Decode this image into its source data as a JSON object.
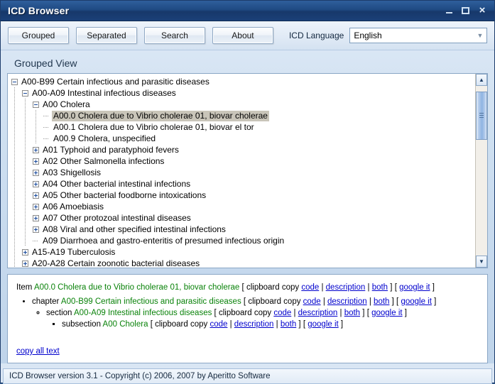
{
  "window": {
    "title": "ICD Browser",
    "controls": [
      {
        "name": "minimize",
        "glyph": "_"
      },
      {
        "name": "maximize",
        "glyph": "□"
      },
      {
        "name": "close",
        "glyph": "×"
      }
    ]
  },
  "toolbar": {
    "buttons": [
      "Grouped",
      "Separated",
      "Search",
      "About"
    ],
    "language_label": "ICD Language",
    "language_value": "English",
    "language_options": [
      "English"
    ]
  },
  "view": {
    "heading": "Grouped View"
  },
  "tree": {
    "nodes": [
      {
        "depth": 0,
        "toggle": "minus",
        "label": "A00-B99 Certain infectious and parasitic diseases",
        "selected": false
      },
      {
        "depth": 1,
        "toggle": "minus",
        "label": "A00-A09 Intestinal infectious diseases",
        "selected": false
      },
      {
        "depth": 2,
        "toggle": "minus",
        "label": "A00 Cholera",
        "selected": false
      },
      {
        "depth": 3,
        "toggle": "leaf",
        "label": "A00.0 Cholera due to Vibrio cholerae 01, biovar cholerae",
        "selected": true
      },
      {
        "depth": 3,
        "toggle": "leaf",
        "label": "A00.1 Cholera due to Vibrio cholerae 01, biovar el tor",
        "selected": false
      },
      {
        "depth": 3,
        "toggle": "leaf",
        "label": "A00.9 Cholera, unspecified",
        "selected": false
      },
      {
        "depth": 2,
        "toggle": "plus",
        "label": "A01 Typhoid and paratyphoid fevers",
        "selected": false
      },
      {
        "depth": 2,
        "toggle": "plus",
        "label": "A02 Other Salmonella infections",
        "selected": false
      },
      {
        "depth": 2,
        "toggle": "plus",
        "label": "A03 Shigellosis",
        "selected": false
      },
      {
        "depth": 2,
        "toggle": "plus",
        "label": "A04 Other bacterial intestinal infections",
        "selected": false
      },
      {
        "depth": 2,
        "toggle": "plus",
        "label": "A05 Other bacterial foodborne intoxications",
        "selected": false
      },
      {
        "depth": 2,
        "toggle": "plus",
        "label": "A06 Amoebiasis",
        "selected": false
      },
      {
        "depth": 2,
        "toggle": "plus",
        "label": "A07 Other protozoal intestinal diseases",
        "selected": false
      },
      {
        "depth": 2,
        "toggle": "plus",
        "label": "A08 Viral and other specified intestinal infections",
        "selected": false
      },
      {
        "depth": 2,
        "toggle": "leaf",
        "label": "A09 Diarrhoea and gastro-enteritis of presumed infectious origin",
        "selected": false
      },
      {
        "depth": 1,
        "toggle": "plus",
        "label": "A15-A19 Tuberculosis",
        "selected": false
      },
      {
        "depth": 1,
        "toggle": "plus",
        "label": "A20-A28 Certain zoonotic bacterial diseases",
        "selected": false
      }
    ],
    "scrollbar": {
      "up_glyph": "▲",
      "down_glyph": "▼"
    }
  },
  "detail": {
    "item": {
      "prefix": "Item",
      "code_text": "A00.0 Cholera due to Vibrio cholerae 01, biovar cholerae",
      "open_bracket": "[",
      "clipboard_label": "clipboard copy",
      "link_code": "code",
      "sep": "|",
      "link_description": "description",
      "link_both": "both",
      "close_bracket": "]",
      "google_open": "[",
      "link_google": "google it",
      "google_close": "]"
    },
    "chapter": {
      "prefix": "chapter",
      "code_text": "A00-B99 Certain infectious and parasitic diseases",
      "open_bracket": "[",
      "clipboard_label": "clipboard copy",
      "link_code": "code",
      "sep": "|",
      "link_description": "description",
      "link_both": "both",
      "close_bracket": "]",
      "google_open": "[",
      "link_google": "google it",
      "google_close": "]"
    },
    "section": {
      "prefix": "section",
      "code_text": "A00-A09 Intestinal infectious diseases",
      "open_bracket": "[",
      "clipboard_label": "clipboard copy",
      "link_code": "code",
      "sep": "|",
      "link_description": "description",
      "link_both": "both",
      "close_bracket": "]",
      "google_open": "[",
      "link_google": "google it",
      "google_close": "]"
    },
    "subsection": {
      "prefix": "subsection",
      "code_text": "A00 Cholera",
      "open_bracket": "[",
      "clipboard_label": "clipboard copy",
      "link_code": "code",
      "sep": "|",
      "link_description": "description",
      "link_both": "both",
      "close_bracket": "]",
      "google_open": "[",
      "link_google": "google it",
      "google_close": "]"
    },
    "copy_all": "copy all text"
  },
  "statusbar": {
    "text": "ICD Browser version 3.1 - Copyright (c) 2006, 2007 by Aperitto Software"
  },
  "colors": {
    "titlebar": "#1f4a83",
    "code_green": "#098209",
    "link_blue": "#0000cd",
    "selection": "#c9c5b9",
    "panel_bg": "#ffffff"
  }
}
